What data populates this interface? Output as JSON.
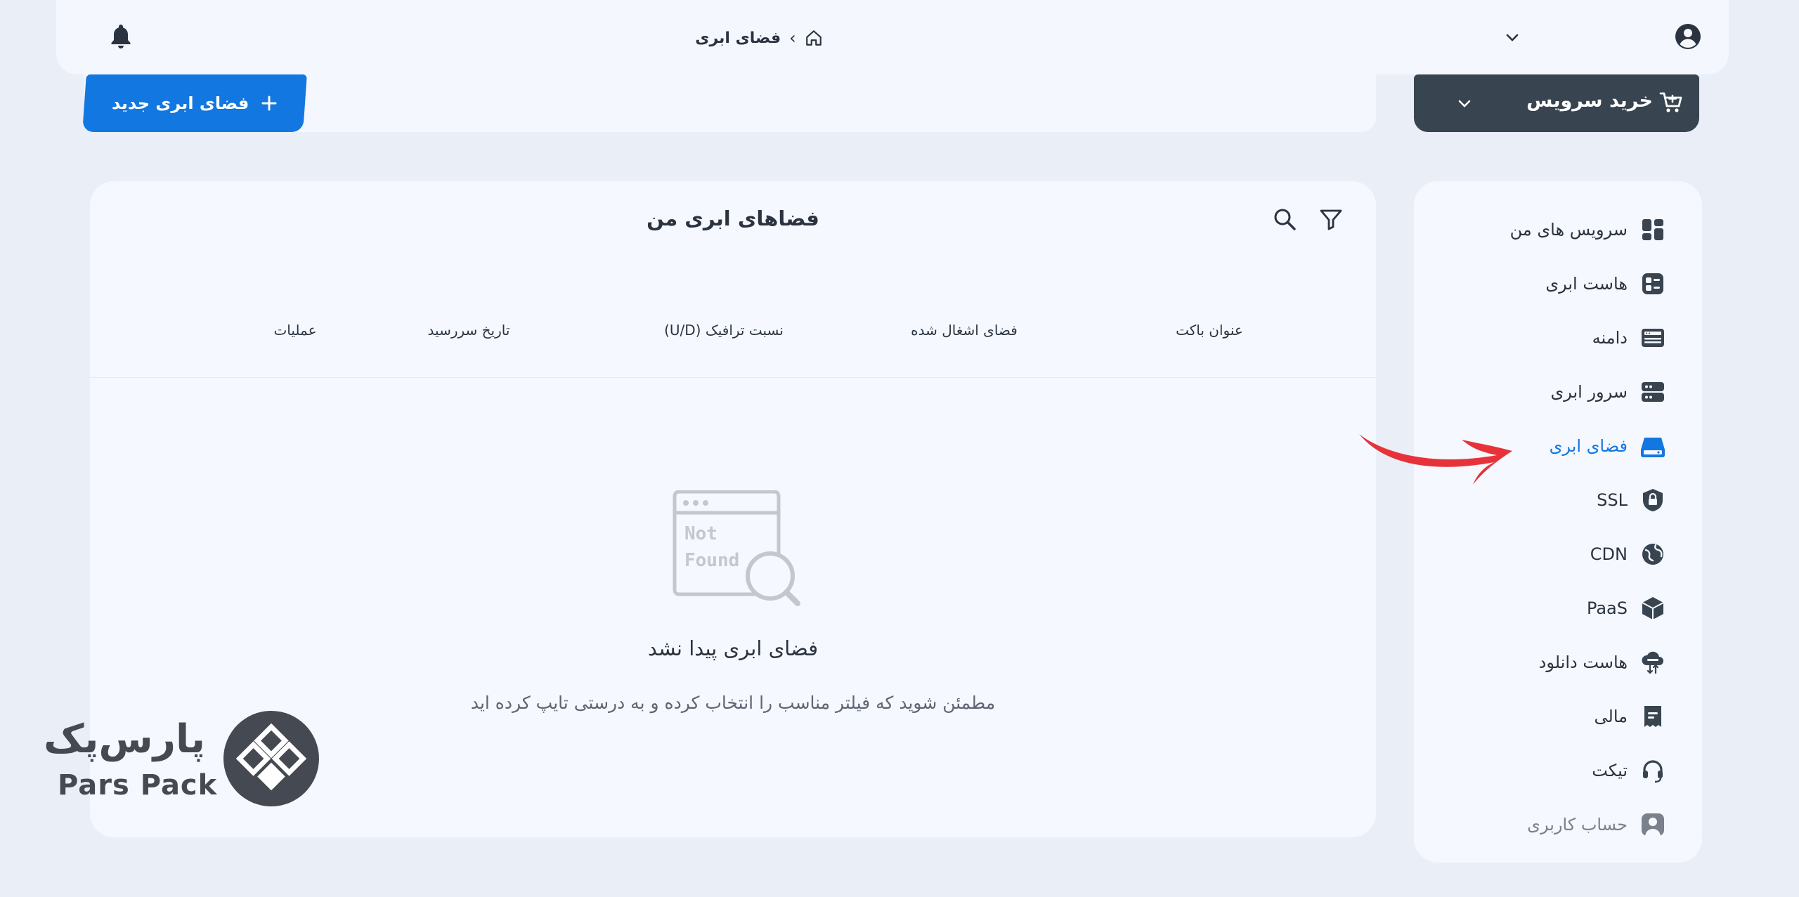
{
  "header": {
    "breadcrumb": [
      "فضای ابری"
    ],
    "breadcrumb_separator": "›"
  },
  "toolbar": {
    "new_space_label": "فضای ابری جدید",
    "buy_service_label": "خرید سرویس"
  },
  "main": {
    "title": "فضاهای ابری من",
    "columns": [
      "عنوان باکت",
      "فضای اشغال شده",
      "نسبت ترافیک (U/D)",
      "تاریخ سررسید",
      "عملیات"
    ],
    "empty_illustration_text": [
      "Not",
      "Found"
    ],
    "empty_title": "فضای ابری پیدا نشد",
    "empty_description": "مطمئن شوید که فیلتر مناسب را انتخاب کرده و به درستی تایپ کرده اید"
  },
  "sidebar": {
    "items": [
      {
        "label": "سرویس های من",
        "icon": "dashboard-icon"
      },
      {
        "label": "هاست ابری",
        "icon": "cloud-host-icon"
      },
      {
        "label": "دامنه",
        "icon": "domain-icon"
      },
      {
        "label": "سرور ابری",
        "icon": "server-icon"
      },
      {
        "label": "فضای ابری",
        "icon": "cloud-storage-icon",
        "active": true
      },
      {
        "label": "SSL",
        "icon": "ssl-shield-icon"
      },
      {
        "label": "CDN",
        "icon": "cdn-globe-icon"
      },
      {
        "label": "PaaS",
        "icon": "paas-box-icon"
      },
      {
        "label": "هاست دانلود",
        "icon": "download-host-icon"
      },
      {
        "label": "مالی",
        "icon": "finance-icon"
      },
      {
        "label": "تیکت",
        "icon": "headset-icon"
      },
      {
        "label": "حساب کاربری",
        "icon": "account-icon"
      }
    ]
  },
  "logo": {
    "text_en": "Pars Pack",
    "text_fa": "پارس‌پک"
  },
  "colors": {
    "accent": "#1277e1",
    "dark": "#38444f",
    "arrow": "#e8323a",
    "background": "#eaeef7"
  }
}
